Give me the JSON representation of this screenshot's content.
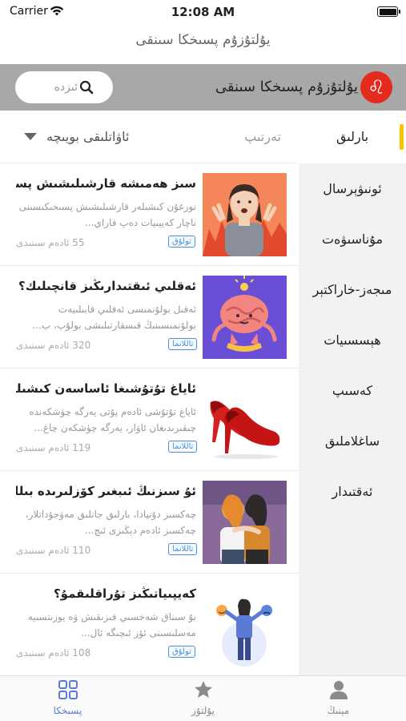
{
  "status_bar": {
    "carrier": "Carrier",
    "time": "12:08 AM"
  },
  "nav": {
    "title": "يۇلتۇزۇم پسىخكا سىنقى"
  },
  "header": {
    "search_placeholder": "ئىزدە",
    "app_name": "يۇلتۇزۇم پسىخكا سىنقى",
    "logo_glyph": "♌"
  },
  "filters": {
    "sort_order": "تەرتىپ",
    "sort_age": "ئاۋاتلىقى بويىچە"
  },
  "categories": [
    {
      "label": "بارلىق",
      "active": true
    },
    {
      "label": "ئونىۋېرسال"
    },
    {
      "label": "مۇناسىۋەت"
    },
    {
      "label": "مىجەز-خاراكتېر"
    },
    {
      "label": "ھېسسىيات"
    },
    {
      "label": "كەسىپ"
    },
    {
      "label": "ساغلاملىق"
    },
    {
      "label": "ئەقتىدار"
    }
  ],
  "items": [
    {
      "title": "سىز ھەمىشە قارشىلىشىش پسىخ...",
      "desc": "نورغۇن كىشىلەر قارشىلىشىش پسىخىكىسىنى ناچار كەيپىيات دەپ قاراي...",
      "count": "55 ئادەم سىنىدى",
      "tag": "تولۇق",
      "thumb": "frustrated-person"
    },
    {
      "title": "ئەقلىي ئىقتىدارىڭىز قانچىلىك؟",
      "desc": "ئەقىل بولۇنمىسى ئەقلىي قابىلىيەت بولۇنمىسىنىڭ قىسقارتىلىشى بولۇپ، ب...",
      "count": "320 ئادەم سىنىدى",
      "tag": "تاللانما",
      "thumb": "brain"
    },
    {
      "title": "ئاياغ تۇتۇشىغا ئاساسەن كىشىلەرنى...",
      "desc": "ئاياغ تۇتۇشى ئادەم پۇتى يەرگە چۈشكەندە چىقىرىدىغان ئاۋاز، يەرگە چۈشكەن چاغ...",
      "count": "119 ئادەم سىنىدى",
      "tag": "تاللانما",
      "thumb": "red-heels"
    },
    {
      "title": "ئۇ سىزنىڭ ئىبغىر كۆزلىرىدە بىللە بو...",
      "desc": "چەكسىز دۇنيادا، بارلىق جانلىق مەۋجۇداتلار، چەكسىز ئادەم دېڭىزى ئىچ...",
      "count": "110 ئادەم سىنىدى",
      "tag": "تاللانما",
      "thumb": "friends"
    },
    {
      "title": "كەيپىياتىڭىز تۇراقلىقمۇ؟",
      "desc": "بۇ سىناق شەخسىي قىزىقىش ۋە يوزىتسىيە مەسلىسىنى ئۆز ئىچىگە ئال...",
      "count": "108 ئادەم سىنىدى",
      "tag": "تولۇق",
      "thumb": "mood"
    }
  ],
  "tabbar": [
    {
      "label": "پسىخكا",
      "icon": "grid-icon",
      "active": true
    },
    {
      "label": "يۇلتۇز",
      "icon": "star-icon"
    },
    {
      "label": "مېنىڭ",
      "icon": "person-icon"
    }
  ]
}
